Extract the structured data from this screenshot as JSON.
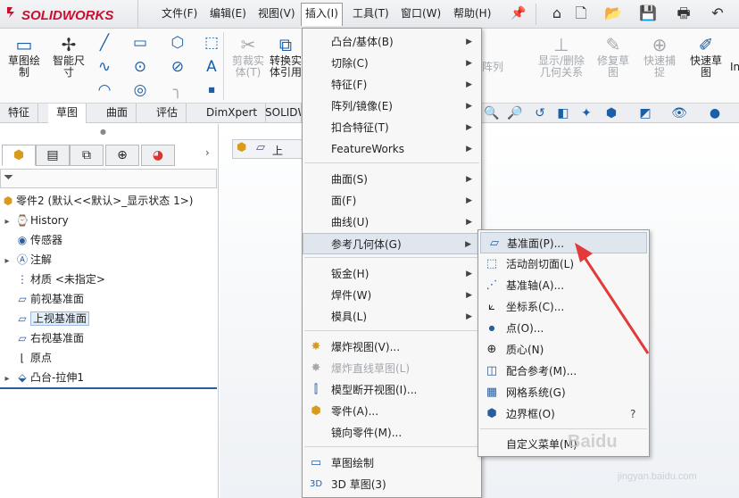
{
  "app": {
    "logo_text": "SOLIDWORKS"
  },
  "menubar": {
    "file": "文件(F)",
    "edit": "编辑(E)",
    "view": "视图(V)",
    "insert": "插入(I)",
    "tools": "工具(T)",
    "window": "窗口(W)",
    "help": "帮助(H)"
  },
  "ribbon": {
    "sketch": "草图绘\n制",
    "smart_dim": "智能尺\n寸",
    "trim": "剪裁实\n体(T)",
    "convert": "转换实\n体引用",
    "delete_rel_1": "显示/删除",
    "delete_rel_2": "几何关系",
    "repair_1": "修复草",
    "repair_2": "图",
    "quick_snap_1": "快速捕",
    "quick_snap_2": "捉",
    "quick_sketch_1": "快速草",
    "quick_sketch_2": "图",
    "array": "阵列",
    "cut_label": "In"
  },
  "tabs": [
    "特征",
    "草图",
    "曲面",
    "评估",
    "DimXpert",
    "SOLIDW"
  ],
  "tree": {
    "root": "零件2  (默认<<默认>_显示状态 1>)",
    "items": [
      "History",
      "传感器",
      "注解",
      "材质 <未指定>",
      "前视基准面",
      "上视基准面",
      "右视基准面",
      "原点",
      "凸台-拉伸1"
    ]
  },
  "breadcrumb": {
    "label": "上"
  },
  "insert_menu": {
    "items": [
      "凸台/基体(B)",
      "切除(C)",
      "特征(F)",
      "阵列/镜像(E)",
      "扣合特征(T)",
      "FeatureWorks",
      "曲面(S)",
      "面(F)",
      "曲线(U)",
      "参考几何体(G)",
      "钣金(H)",
      "焊件(W)",
      "模具(L)",
      "爆炸视图(V)...",
      "爆炸直线草图(L)",
      "模型断开视图(I)...",
      "零件(A)...",
      "镜向零件(M)...",
      "草图绘制",
      "3D 草图(3)"
    ]
  },
  "ref_geom_menu": {
    "items": [
      "基准面(P)...",
      "活动剖切面(L)",
      "基准轴(A)...",
      "坐标系(C)...",
      "点(O)...",
      "质心(N)",
      "配合参考(M)...",
      "网格系统(G)",
      "边界框(O)",
      "自定义菜单(M)"
    ]
  },
  "watermark": {
    "line1": "Baidu",
    "line2": "jingyan.baidu.com"
  },
  "colors": {
    "accent": "#c8102e",
    "highlight_arrow": "#e23a3a"
  }
}
